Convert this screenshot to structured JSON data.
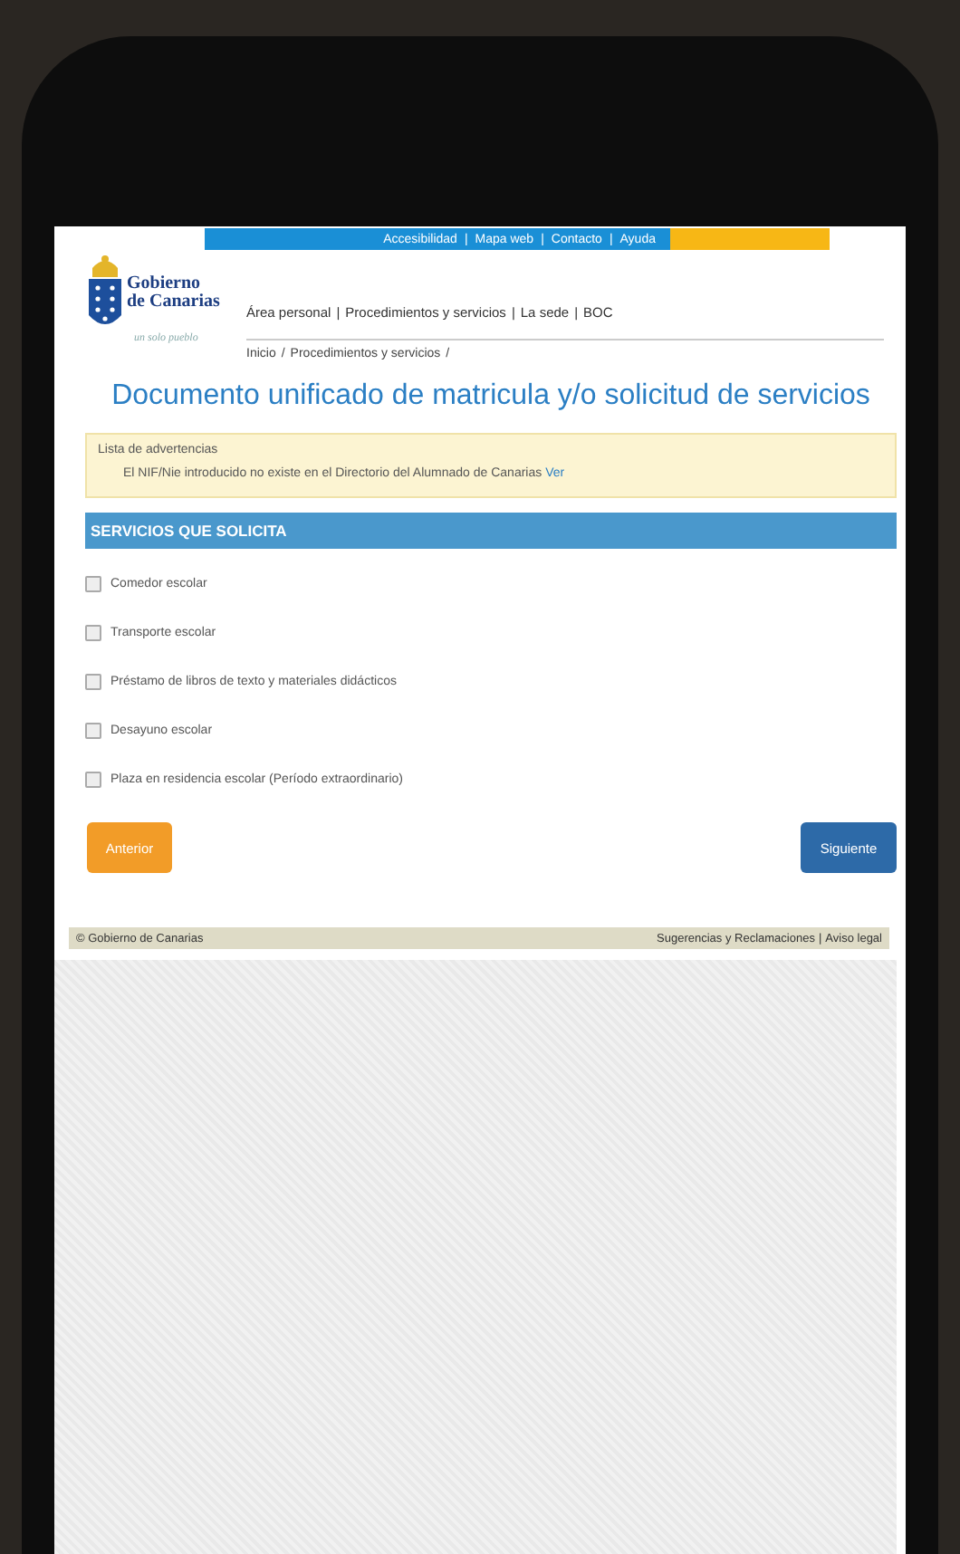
{
  "top_links": {
    "items": [
      "Accesibilidad",
      "Mapa web",
      "Contacto",
      "Ayuda"
    ],
    "separator": "|"
  },
  "brand": {
    "line1": "Gobierno",
    "line2": "de Canarias",
    "tagline": "un solo pueblo"
  },
  "main_nav": {
    "items": [
      "Área personal",
      "Procedimientos y servicios",
      "La sede",
      "BOC"
    ],
    "separator": "|"
  },
  "breadcrumb": {
    "items": [
      "Inicio",
      "Procedimientos y servicios"
    ],
    "separator": "/"
  },
  "title": "Documento unificado de matricula y/o solicitud de servicios",
  "warning": {
    "heading": "Lista de advertencias",
    "message": "El NIF/Nie introducido no existe en el Directorio del Alumnado de Canarias",
    "link": "Ver"
  },
  "section_title": "SERVICIOS QUE SOLICITA",
  "services": [
    {
      "label": "Comedor escolar",
      "checked": false
    },
    {
      "label": "Transporte escolar",
      "checked": false
    },
    {
      "label": "Préstamo de libros de texto y materiales didácticos",
      "checked": false
    },
    {
      "label": "Desayuno escolar",
      "checked": false
    },
    {
      "label": "Plaza en residencia escolar (Período extraordinario)",
      "checked": false
    }
  ],
  "buttons": {
    "previous": "Anterior",
    "next": "Siguiente"
  },
  "footer": {
    "copyright": "© Gobierno de Canarias",
    "links": [
      "Sugerencias y Reclamaciones",
      "Aviso legal"
    ],
    "separator": "|"
  }
}
